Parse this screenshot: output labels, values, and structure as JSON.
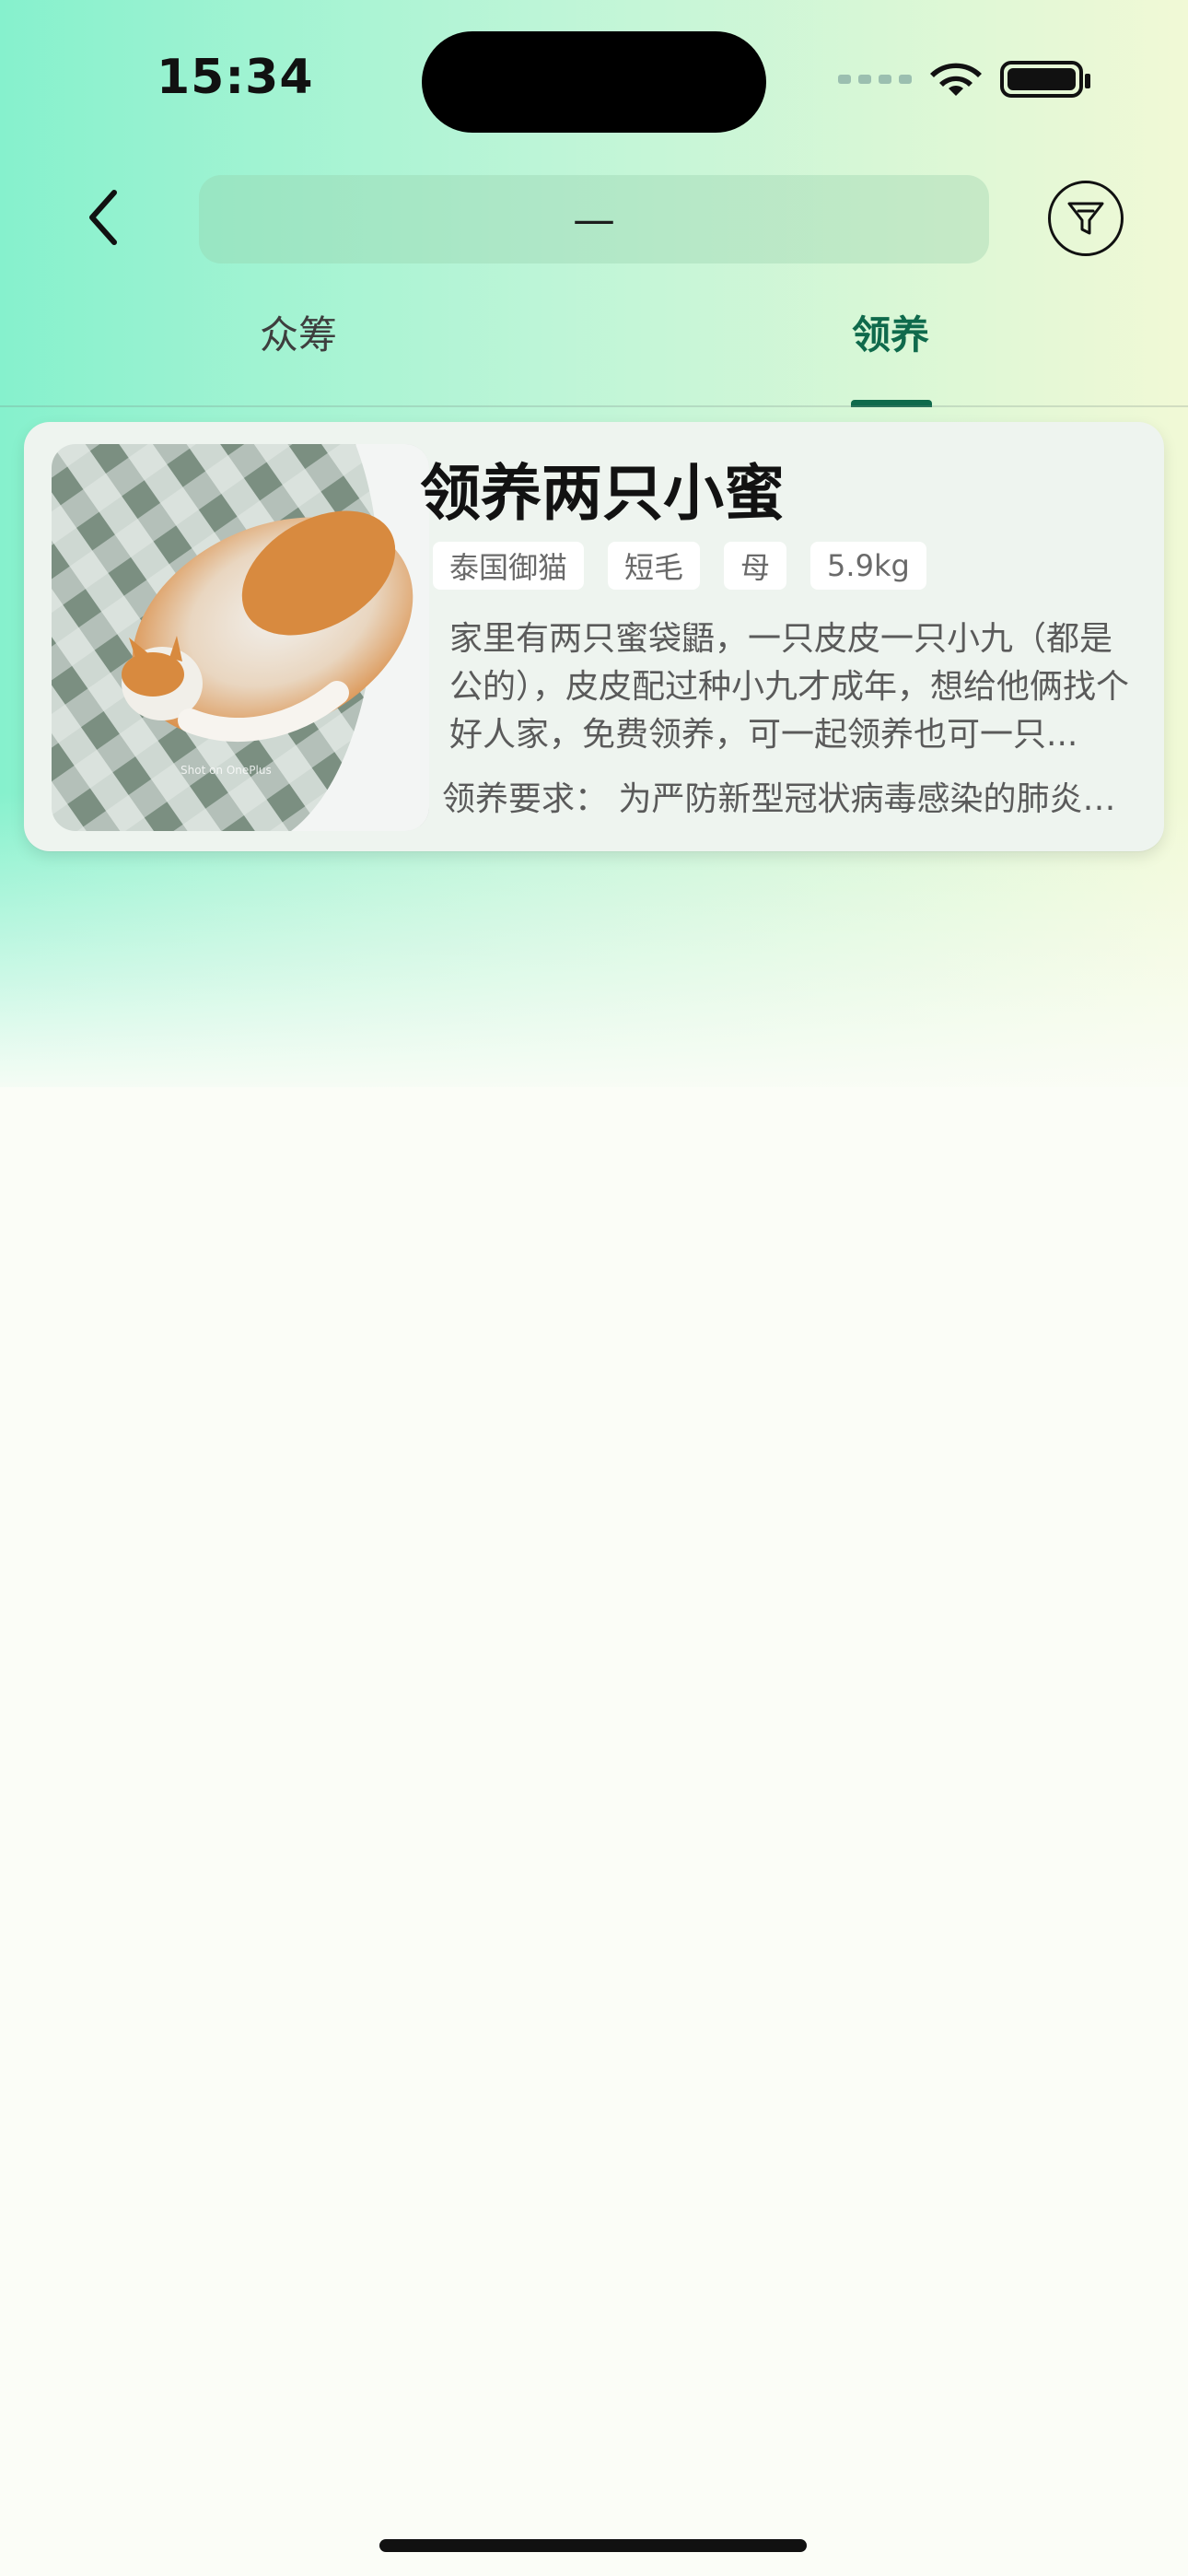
{
  "status_bar": {
    "time": "15:34",
    "icons": [
      "signal-icon",
      "wifi-icon",
      "battery-icon"
    ]
  },
  "header": {
    "back_icon": "chevron-left-icon",
    "search_value": "—",
    "filter_icon": "filter-icon"
  },
  "tabs": [
    {
      "label": "众筹",
      "active": false
    },
    {
      "label": "领养",
      "active": true
    }
  ],
  "card": {
    "title": "领养两只小蜜",
    "tags": [
      "泰国御猫",
      "短毛",
      "母",
      "5.9kg"
    ],
    "description": "家里有两只蜜袋鼯，一只皮皮一只小九（都是公的），皮皮配过种小九才成年，想给他俩找个好人家，免费领养，可一起领养也可一只...",
    "requirement": "领养要求：  为严防新型冠状病毒感染的肺炎疫情..."
  },
  "colors": {
    "accent": "#0f6a4c",
    "background_top_left": "#86f1cd",
    "background_top_right": "#f1f9d6",
    "card_bg": "#eef4ef"
  }
}
